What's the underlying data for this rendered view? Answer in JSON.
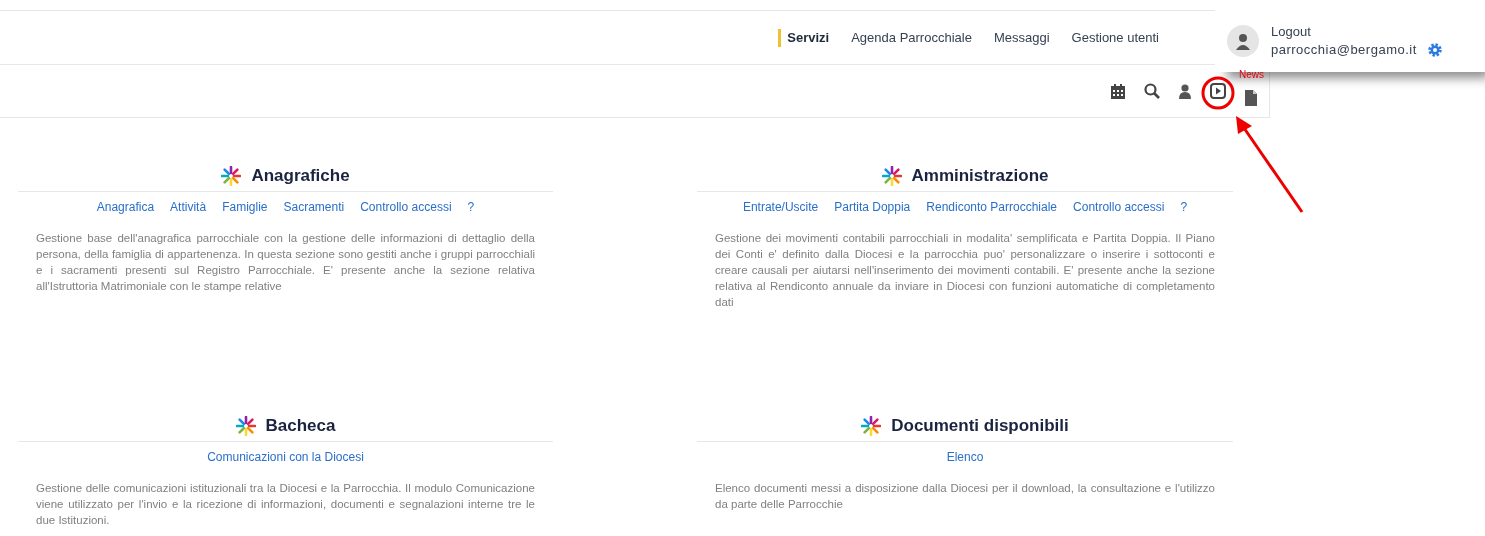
{
  "nav": {
    "items": [
      {
        "label": "Servizi",
        "selected": true
      },
      {
        "label": "Agenda Parrocchiale",
        "selected": false
      },
      {
        "label": "Messaggi",
        "selected": false
      },
      {
        "label": "Gestione utenti",
        "selected": false
      }
    ]
  },
  "user": {
    "logout": "Logout",
    "email": "parrocchia@bergamo.it"
  },
  "toolbar": {
    "news_label": "News"
  },
  "sections": [
    {
      "title": "Anagrafiche",
      "links": [
        "Anagrafica",
        "Attività",
        "Famiglie",
        "Sacramenti",
        "Controllo accessi",
        "?"
      ],
      "description": "Gestione base dell'anagrafica parrocchiale con la gestione delle informazioni di dettaglio della persona, della famiglia di appartenenza. In questa sezione sono gestiti anche i gruppi parrocchiali e i sacramenti presenti sul Registro Parrocchiale. E' presente anche la sezione relativa all'Istruttoria Matrimoniale con le stampe relative"
    },
    {
      "title": "Amministrazione",
      "links": [
        "Entrate/Uscite",
        "Partita Doppia",
        "Rendiconto Parrocchiale",
        "Controllo accessi",
        "?"
      ],
      "description": "Gestione dei movimenti contabili parrocchiali in modalita' semplificata e Partita Doppia. Il Piano dei Conti e' definito dalla Diocesi e la parrocchia puo' personalizzare o inserire i sottoconti e creare causali per aiutarsi nell'inserimento dei movimenti contabili. E' presente anche la sezione relativa al Rendiconto annuale da inviare in Diocesi con funzioni automatiche di completamento dati"
    },
    {
      "title": "Bacheca",
      "links": [
        "Comunicazioni con la Diocesi"
      ],
      "description": "Gestione delle comunicazioni istituzionali tra la Diocesi e la Parrocchia. Il modulo Comunicazione viene utilizzato per l'invio e la ricezione di informazioni, documenti e segnalazioni interne tre le due Istituzioni."
    },
    {
      "title": "Documenti disponibili",
      "links": [
        "Elenco"
      ],
      "description": "Elenco documenti messi a disposizione dalla Diocesi per il download, la consultazione e l'utilizzo da parte delle Parrocchie"
    }
  ]
}
